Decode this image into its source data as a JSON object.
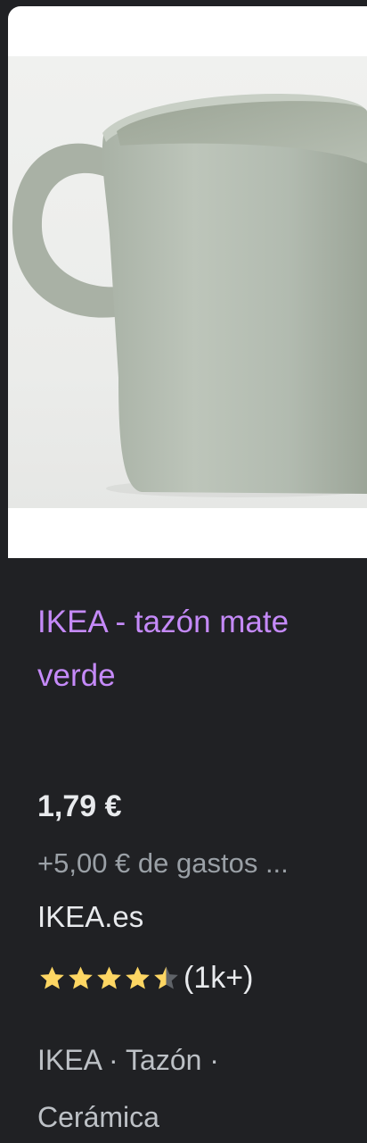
{
  "product": {
    "image_alt": "Taza verde mate",
    "title": "IKEA - tazón mate verde",
    "price": "1,79 €",
    "shipping": "+5,00 € de gastos ...",
    "seller": "IKEA.es",
    "rating": {
      "value": 4.5,
      "max": 5,
      "count_text": "(1k+)"
    },
    "tags": "IKEA · Tazón · Cerámica"
  },
  "colors": {
    "background": "#202124",
    "title": "#c58af9",
    "price": "#e8eaed",
    "muted": "#9aa0a6",
    "star": "#fdd663",
    "star_empty": "#5f6368"
  },
  "icons": {
    "star_full": "star-icon",
    "star_half": "half-star-icon"
  }
}
